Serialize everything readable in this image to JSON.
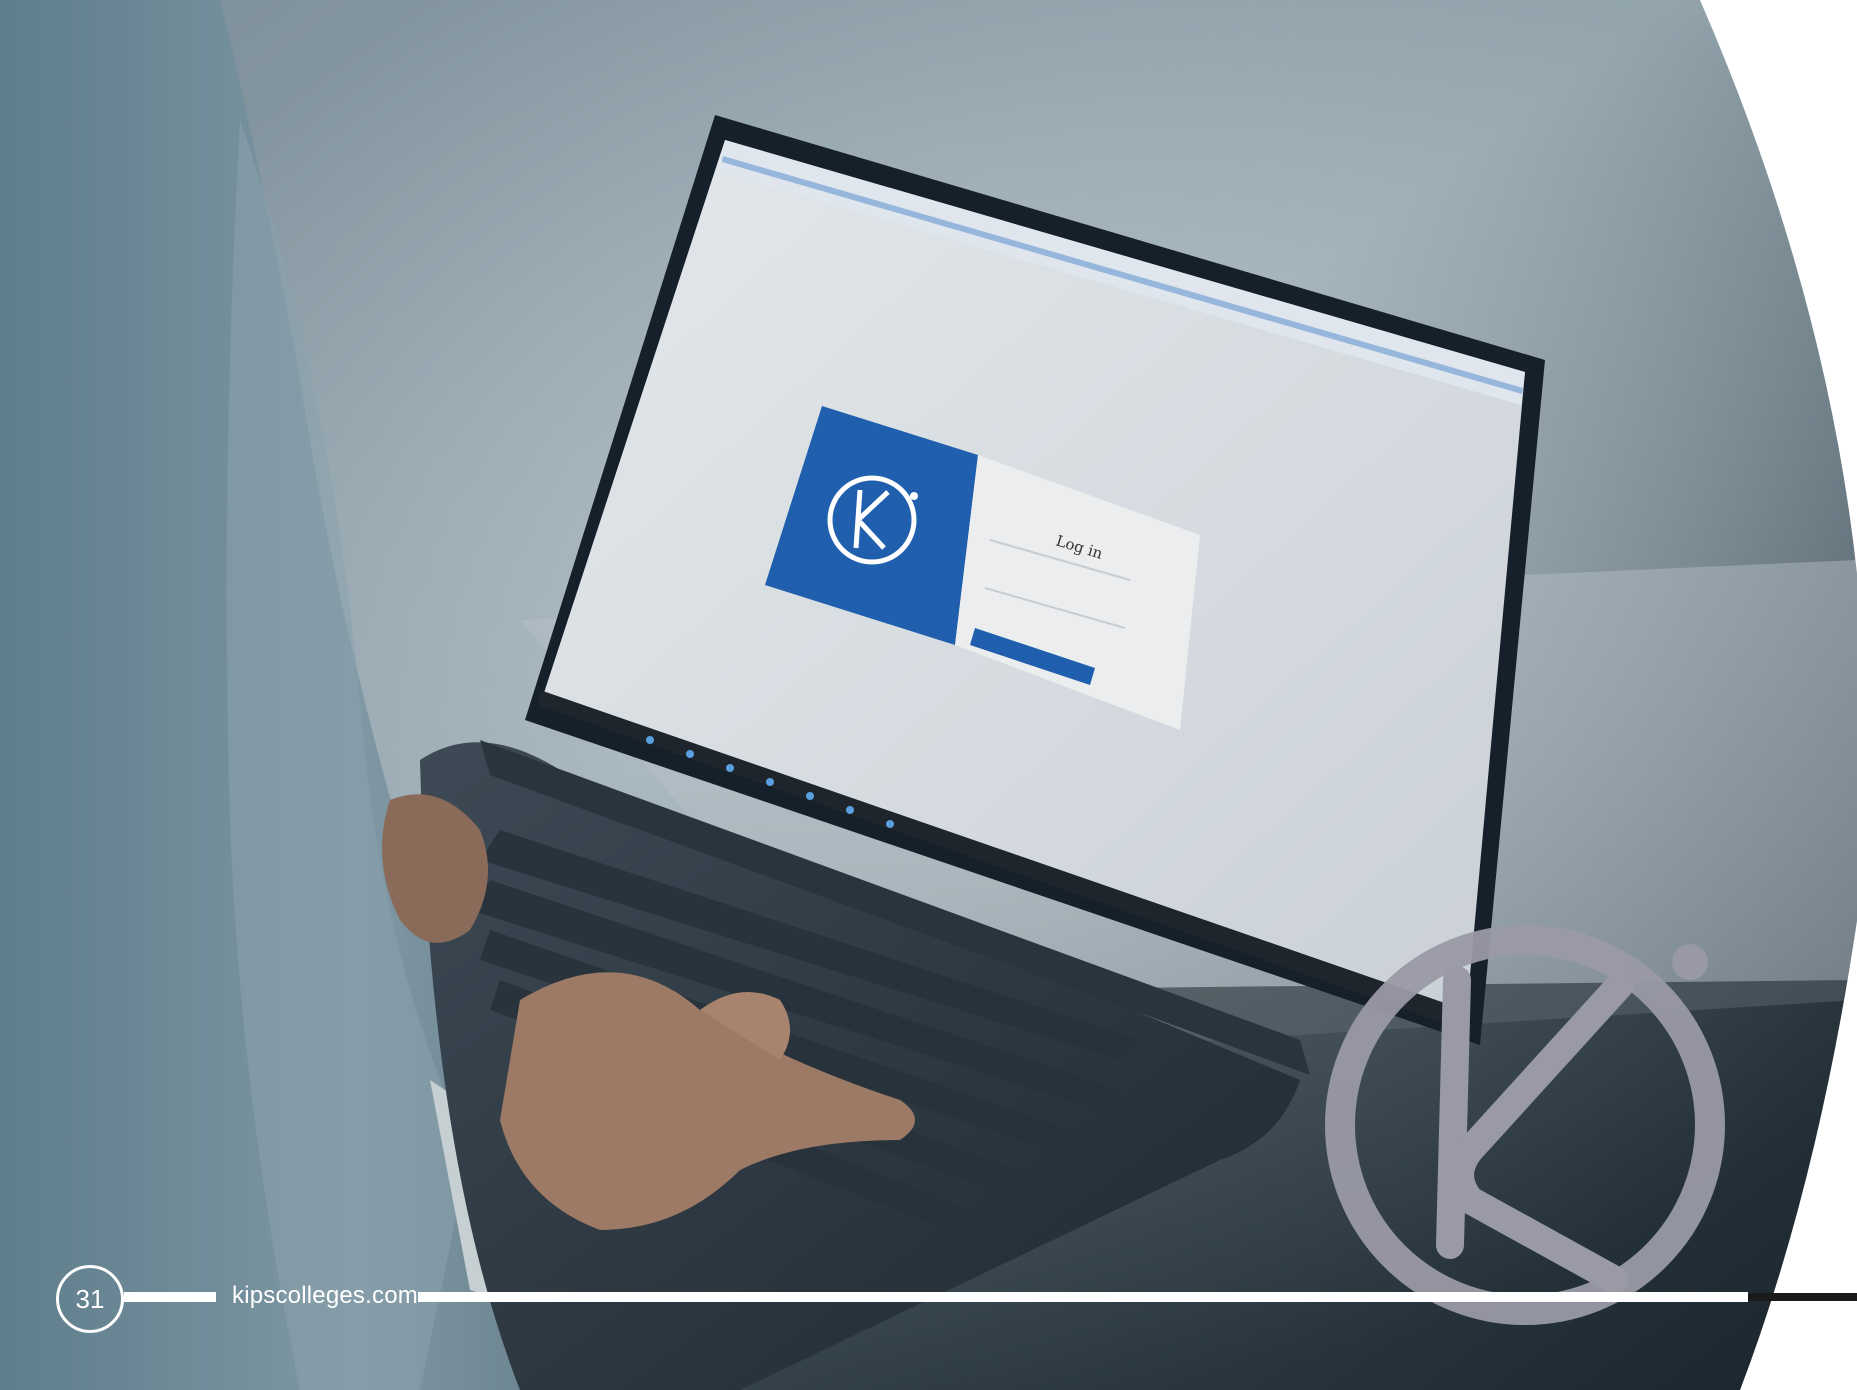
{
  "footer": {
    "page_number": "31",
    "website": "kipscolleges.com"
  },
  "laptop_screen": {
    "login_title": "Log in"
  },
  "colors": {
    "brand_blue": "#1f5fae",
    "watermark_gray": "#9a9aa6",
    "background_dark": "#2c3a45"
  },
  "icons": {
    "brand_logo": "k-circle-logo-icon"
  }
}
